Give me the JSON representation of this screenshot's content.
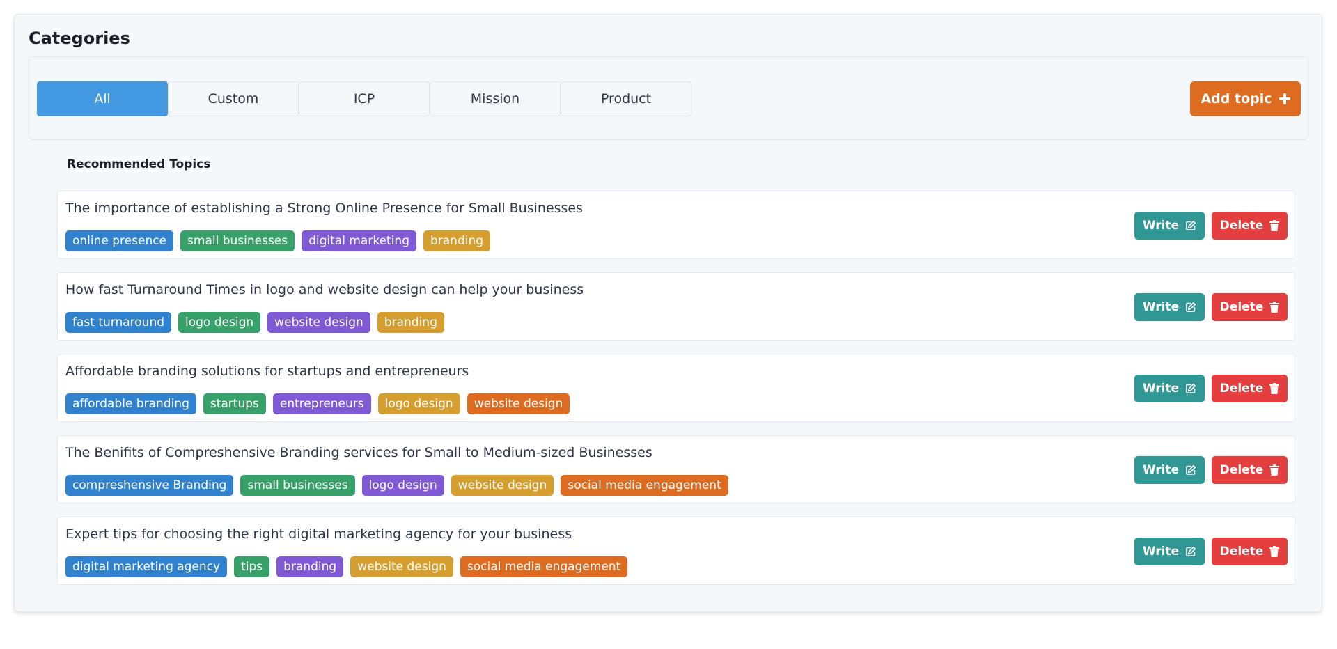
{
  "panel": {
    "title": "Categories"
  },
  "tabs": [
    {
      "label": "All",
      "active": true
    },
    {
      "label": "Custom",
      "active": false
    },
    {
      "label": "ICP",
      "active": false
    },
    {
      "label": "Mission",
      "active": false
    },
    {
      "label": "Product",
      "active": false
    }
  ],
  "add_topic": {
    "label": "Add topic",
    "icon": "plus-icon",
    "color": "#dd6b20"
  },
  "section": {
    "title": "Recommended Topics"
  },
  "actions": {
    "write_label": "Write",
    "write_icon": "edit-icon",
    "write_color": "#319795",
    "delete_label": "Delete",
    "delete_icon": "trash-icon",
    "delete_color": "#e53e3e"
  },
  "tag_colors": [
    "#3182ce",
    "#38a169",
    "#805ad5",
    "#d69e2e",
    "#dd6b20"
  ],
  "topics": [
    {
      "title": "The importance of establishing a Strong Online Presence for Small Businesses",
      "tags": [
        "online presence",
        "small businesses",
        "digital marketing",
        "branding"
      ]
    },
    {
      "title": "How fast Turnaround Times in logo and website design can help your business",
      "tags": [
        "fast turnaround",
        "logo design",
        "website design",
        "branding"
      ]
    },
    {
      "title": "Affordable branding solutions for startups and entrepreneurs",
      "tags": [
        "affordable branding",
        "startups",
        "entrepreneurs",
        "logo design",
        "website design"
      ]
    },
    {
      "title": "The Benifits of Compreshensive Branding services for Small to Medium-sized Businesses",
      "tags": [
        "compreshensive Branding",
        "small businesses",
        "logo design",
        "website design",
        "social media engagement"
      ]
    },
    {
      "title": "Expert tips for choosing the right digital marketing agency for your business",
      "tags": [
        "digital marketing agency",
        "tips",
        "branding",
        "website design",
        "social media engagement"
      ]
    }
  ]
}
